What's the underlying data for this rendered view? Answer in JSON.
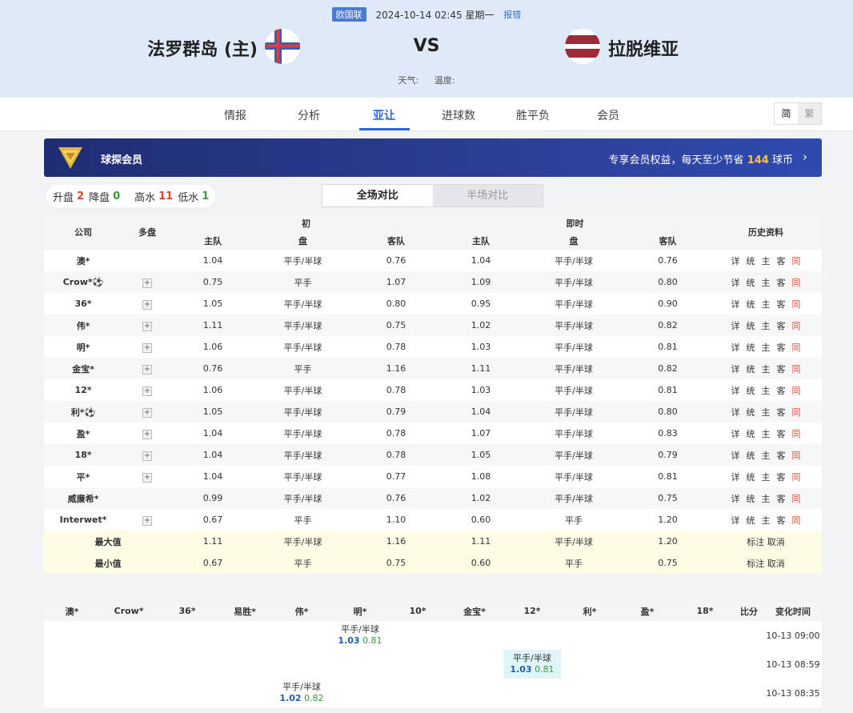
{
  "header": {
    "league": "欧国联",
    "datetime": "2024-10-14 02:45 星期一",
    "report": "报错",
    "home_team": "法罗群岛 (主)",
    "away_team": "拉脱维亚",
    "vs": "VS",
    "weather_label": "天气:",
    "temp_label": "温度:"
  },
  "tabs": [
    {
      "label": "情报"
    },
    {
      "label": "分析"
    },
    {
      "label": "亚让"
    },
    {
      "label": "进球数"
    },
    {
      "label": "胜平负"
    },
    {
      "label": "会员"
    }
  ],
  "active_tab": "亚让",
  "lang": {
    "simplified": "简",
    "traditional": "繁"
  },
  "member_banner": {
    "title": "球探会员",
    "promo_prefix": "专享会员权益，每天至少节省",
    "promo_amount": "144",
    "promo_suffix": "球币",
    "chevron": "›"
  },
  "stats": {
    "up_label": "升盘",
    "up": "2",
    "down_label": "降盘",
    "down": "0",
    "high_label": "高水",
    "high": "11",
    "low_label": "低水",
    "low": "1"
  },
  "segment": {
    "full": "全场对比",
    "half": "半场对比"
  },
  "odds_table": {
    "headers": {
      "company": "公司",
      "multi": "多盘",
      "initial": "初",
      "live": "即时",
      "history": "历史资料",
      "home": "主队",
      "line": "盘",
      "away": "客队"
    },
    "history_links": [
      "详",
      "统",
      "主",
      "客",
      "同"
    ],
    "rows": [
      {
        "company": "澳*",
        "multi": false,
        "ih": "1.04",
        "il": "平手/半球",
        "ia": "0.76",
        "lh": "1.04",
        "ll": "平手/半球",
        "la": "0.76"
      },
      {
        "company": "Crow*⚽",
        "multi": true,
        "ih": "0.75",
        "il": "平手",
        "ia": "1.07",
        "lh": "1.09",
        "ll": "平手/半球",
        "la": "0.80"
      },
      {
        "company": "36*",
        "multi": true,
        "ih": "1.05",
        "il": "平手/半球",
        "ia": "0.80",
        "lh": "0.95",
        "ll": "平手/半球",
        "la": "0.90"
      },
      {
        "company": "伟*",
        "multi": true,
        "ih": "1.11",
        "il": "平手/半球",
        "ia": "0.75",
        "lh": "1.02",
        "ll": "平手/半球",
        "la": "0.82"
      },
      {
        "company": "明*",
        "multi": true,
        "ih": "1.06",
        "il": "平手/半球",
        "ia": "0.78",
        "lh": "1.03",
        "ll": "平手/半球",
        "la": "0.81"
      },
      {
        "company": "金宝*",
        "multi": true,
        "ih": "0.76",
        "il": "平手",
        "ia": "1.16",
        "lh": "1.11",
        "ll": "平手/半球",
        "la": "0.82"
      },
      {
        "company": "12*",
        "multi": true,
        "ih": "1.06",
        "il": "平手/半球",
        "ia": "0.78",
        "lh": "1.03",
        "ll": "平手/半球",
        "la": "0.81"
      },
      {
        "company": "利*⚽",
        "multi": true,
        "ih": "1.05",
        "il": "平手/半球",
        "ia": "0.79",
        "lh": "1.04",
        "ll": "平手/半球",
        "la": "0.80"
      },
      {
        "company": "盈*",
        "multi": true,
        "ih": "1.04",
        "il": "平手/半球",
        "ia": "0.78",
        "lh": "1.07",
        "ll": "平手/半球",
        "la": "0.83"
      },
      {
        "company": "18*",
        "multi": true,
        "ih": "1.04",
        "il": "平手/半球",
        "ia": "0.78",
        "lh": "1.05",
        "ll": "平手/半球",
        "la": "0.79"
      },
      {
        "company": "平*",
        "multi": true,
        "ih": "1.04",
        "il": "平手/半球",
        "ia": "0.77",
        "lh": "1.08",
        "ll": "平手/半球",
        "la": "0.81"
      },
      {
        "company": "威廉希*",
        "multi": false,
        "ih": "0.99",
        "il": "平手/半球",
        "ia": "0.76",
        "lh": "1.02",
        "ll": "平手/半球",
        "la": "0.75"
      },
      {
        "company": "Interwet*",
        "multi": true,
        "ih": "0.67",
        "il": "平手",
        "ia": "1.10",
        "lh": "0.60",
        "ll": "平手",
        "la": "1.20"
      }
    ],
    "summary": [
      {
        "label": "最大值",
        "ih": "1.11",
        "il": "平手/半球",
        "ia": "1.16",
        "lh": "1.11",
        "ll": "平手/半球",
        "la": "1.20"
      },
      {
        "label": "最小值",
        "ih": "0.67",
        "il": "平手",
        "ia": "0.75",
        "lh": "0.60",
        "ll": "平手",
        "la": "0.75"
      }
    ],
    "summary_links": {
      "mark": "标注",
      "cancel": "取消"
    }
  },
  "change_table": {
    "headers": [
      "澳*",
      "Crow*",
      "36*",
      "易胜*",
      "伟*",
      "明*",
      "10*",
      "金宝*",
      "12*",
      "利*",
      "盈*",
      "18*",
      "比分",
      "变化时间"
    ],
    "rows": [
      {
        "col": 5,
        "line": "平手/半球",
        "home": "1.03",
        "away": "0.81",
        "time": "10-13 09:00",
        "highlight": false
      },
      {
        "col": 8,
        "line": "平手/半球",
        "home": "1.03",
        "away": "0.81",
        "time": "10-13 08:59",
        "highlight": true
      },
      {
        "col": 4,
        "line": "平手/半球",
        "home": "1.02",
        "away": "0.82",
        "time": "10-13 08:35",
        "highlight": false
      }
    ]
  },
  "colors": {
    "accent": "#2a6ad6",
    "up": "#e0452b",
    "down": "#3a9a3a",
    "banner": "#1f2d73",
    "gold": "#f7c444"
  }
}
